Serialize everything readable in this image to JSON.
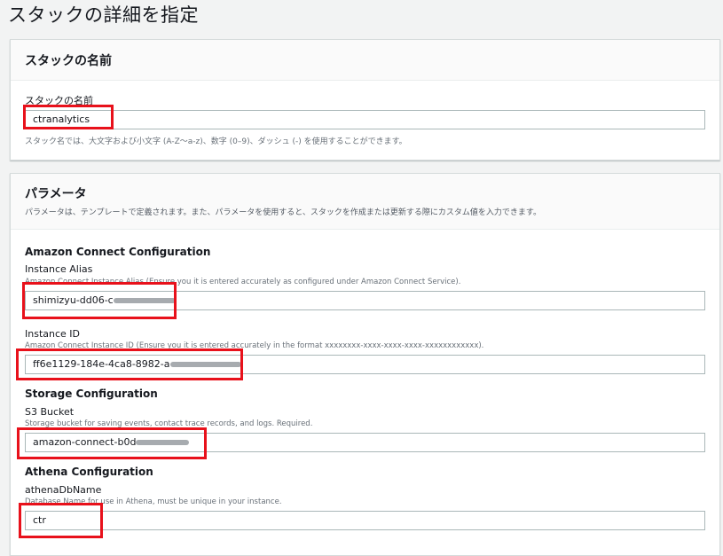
{
  "page": {
    "title": "スタックの詳細を指定"
  },
  "stack_name": {
    "section_title": "スタックの名前",
    "label": "スタックの名前",
    "value": "ctranalytics",
    "hint": "スタック名では、大文字および小文字 (A-Z〜a-z)、数字 (0–9)、ダッシュ (-) を使用することができます。"
  },
  "parameters": {
    "title": "パラメータ",
    "description": "パラメータは、テンプレートで定義されます。また、パラメータを使用すると、スタックを作成または更新する際にカスタム値を入力できます。",
    "groups": [
      {
        "title": "Amazon Connect Configuration",
        "fields": [
          {
            "label": "Instance Alias",
            "description": "Amazon Connect Instance Alias (Ensure you it is entered accurately as configured under Amazon Connect Service).",
            "value": "shimizyu-dd06-c"
          },
          {
            "label": "Instance ID",
            "description": "Amazon Connect Instance ID (Ensure you it is entered accurately in the format xxxxxxxx-xxxx-xxxx-xxxx-xxxxxxxxxxxx).",
            "value": "ff6e1129-184e-4ca8-8982-a"
          }
        ]
      },
      {
        "title": "Storage Configuration",
        "fields": [
          {
            "label": "S3 Bucket",
            "description": "Storage bucket for saving events, contact trace records, and logs. Required.",
            "value": "amazon-connect-b0d"
          }
        ]
      },
      {
        "title": "Athena Configuration",
        "fields": [
          {
            "label": "athenaDbName",
            "description": "Database Name for use in Athena, must be unique in your instance.",
            "value": "ctr"
          }
        ]
      }
    ]
  },
  "colors": {
    "highlight": "#e8111b",
    "panel_border": "#d5dbdb",
    "background": "#f2f3f3"
  }
}
